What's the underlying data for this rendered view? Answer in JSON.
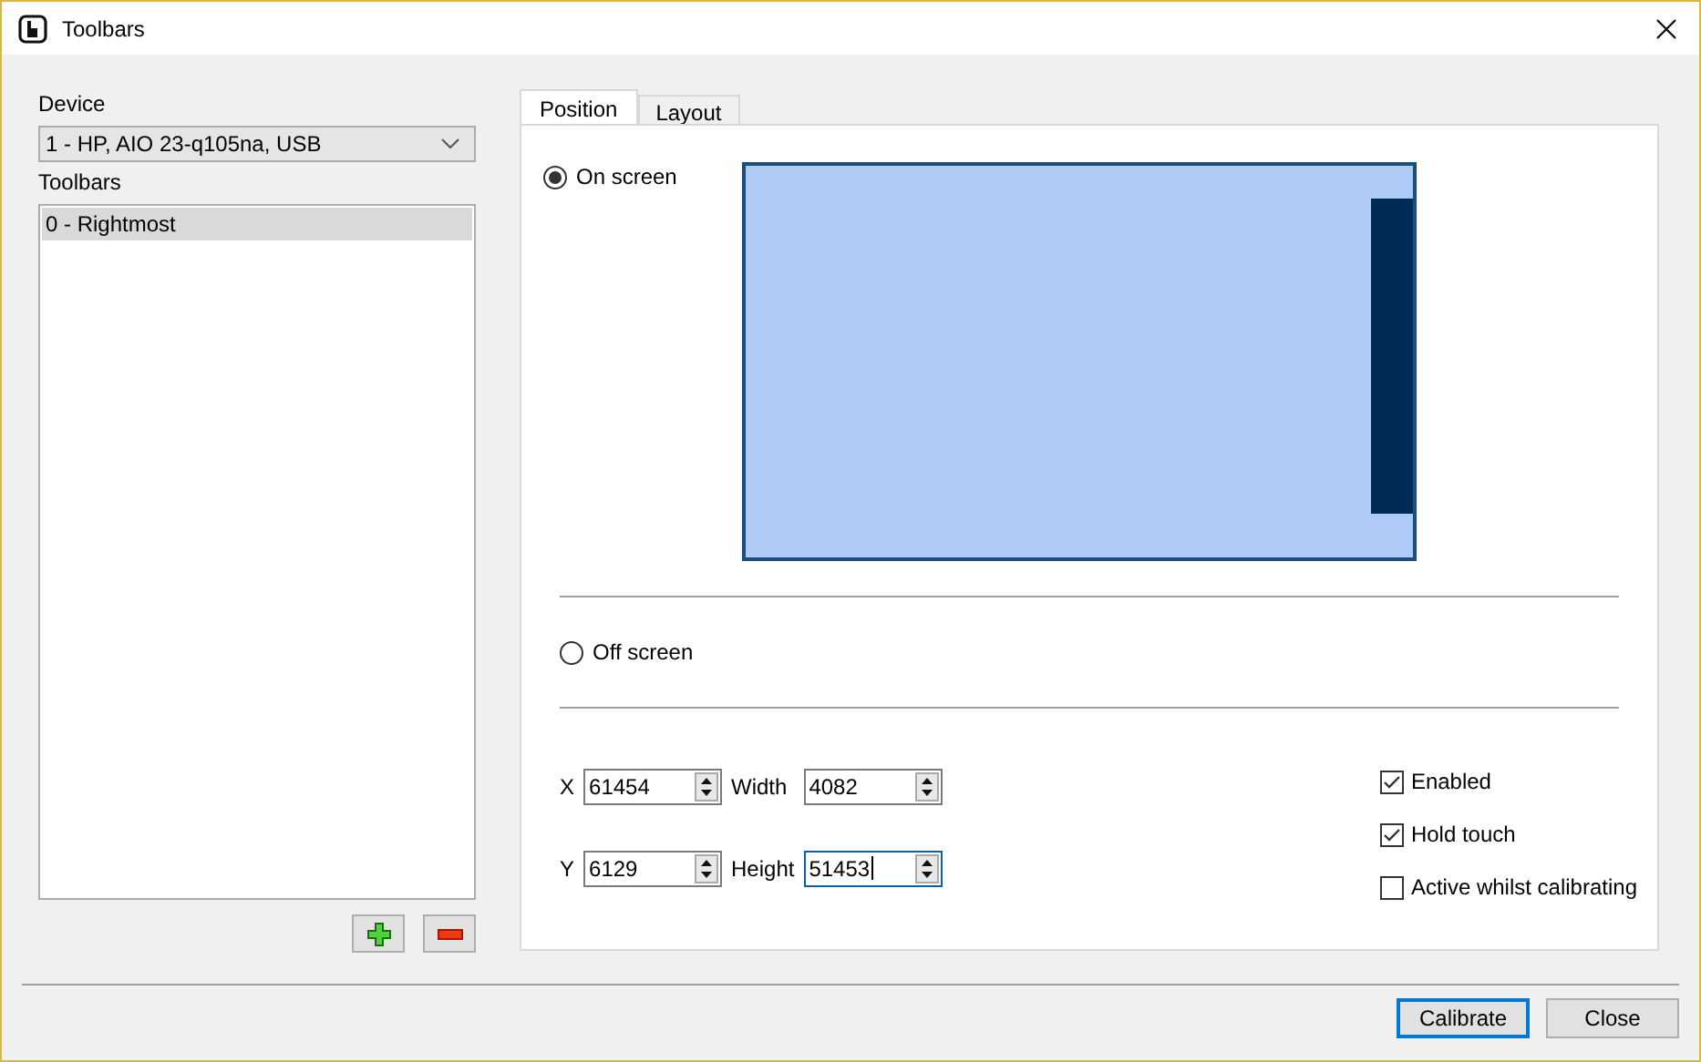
{
  "window": {
    "title": "Toolbars"
  },
  "device": {
    "label": "Device",
    "value": "1 - HP, AIO 23-q105na, USB"
  },
  "toolbars": {
    "label": "Toolbars",
    "items": [
      {
        "label": "0 - Rightmost",
        "selected": true
      }
    ]
  },
  "tabs": [
    {
      "label": "Position",
      "selected": true
    },
    {
      "label": "Layout",
      "selected": false
    }
  ],
  "placement": [
    {
      "label": "On screen",
      "selected": true
    },
    {
      "label": "Off screen",
      "selected": false
    }
  ],
  "fields": [
    {
      "label": "X",
      "value": "61454",
      "focused": false
    },
    {
      "label": "Width",
      "value": "4082",
      "focused": false
    },
    {
      "label": "Y",
      "value": "6129",
      "focused": false
    },
    {
      "label": "Height",
      "value": "51453",
      "focused": true
    }
  ],
  "options": [
    {
      "label": "Enabled",
      "checked": true
    },
    {
      "label": "Hold touch",
      "checked": true
    },
    {
      "label": "Active whilst calibrating",
      "checked": false
    }
  ],
  "buttons": [
    {
      "label": "Calibrate",
      "default": true
    },
    {
      "label": "Close",
      "default": false
    }
  ]
}
